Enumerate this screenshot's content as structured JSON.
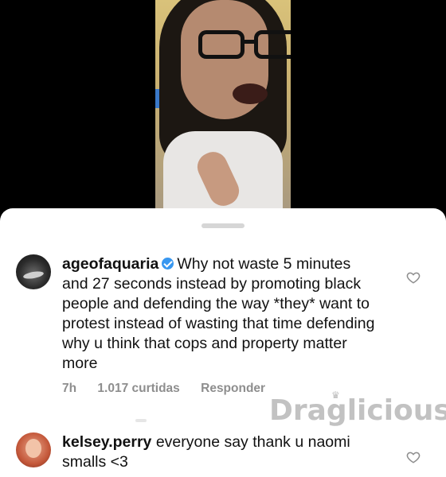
{
  "comments": [
    {
      "username": "ageofaquaria",
      "verified": true,
      "text": "Why not waste 5 minutes and 27 seconds instead by promoting black people and defending the way *they* want to protest instead of wasting that time defending why u think that cops and property matter more",
      "time": "7h",
      "likes": "1.017 curtidas",
      "reply_label": "Responder"
    },
    {
      "username": "kelsey.perry",
      "verified": false,
      "text": "everyone say thank u naomi smalls <3"
    }
  ],
  "watermark": "Draglicious",
  "icons": {
    "like": "heart-outline-icon",
    "verified": "verified-badge-icon"
  },
  "colors": {
    "verified_blue": "#3897f0",
    "meta_gray": "#8e8e8e"
  }
}
